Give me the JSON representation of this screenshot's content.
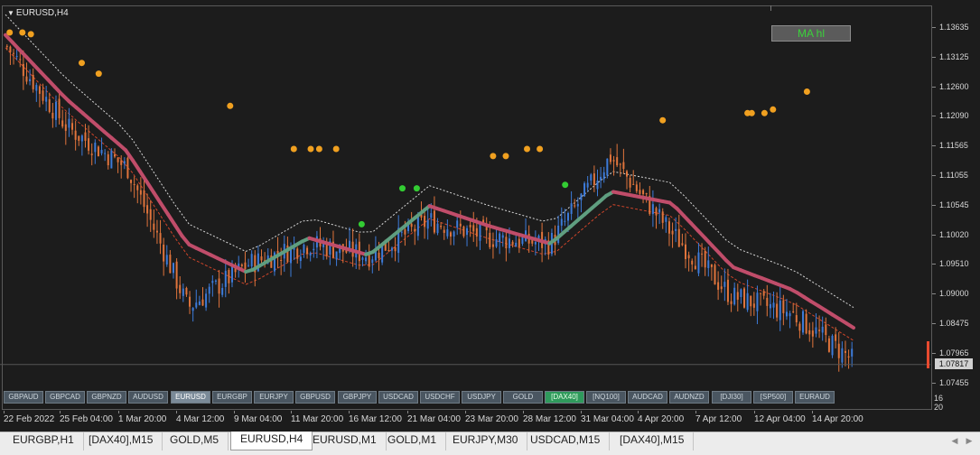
{
  "chart": {
    "symbol_label": "EURUSD,H4",
    "indicator_button": "MA hl",
    "current_price": "1.07817",
    "colors": {
      "background": "#1c1c1c",
      "bull_candle": "#3d7bd9",
      "bear_candle": "#e0743c",
      "ma_down": "#c04d6a",
      "ma_up": "#5f9e80",
      "dots_orange": "#f0a020",
      "dots_green": "#33cc33",
      "envelope_red": "#d0452a",
      "envelope_white": "#d8d8d8"
    },
    "price_axis_labels": [
      "1.13635",
      "1.13125",
      "1.12600",
      "1.12090",
      "1.11565",
      "1.11055",
      "1.10545",
      "1.10020",
      "1.09510",
      "1.09000",
      "1.08475",
      "1.07965",
      "1.07455"
    ],
    "time_axis_labels": [
      "22 Feb 2022",
      "25 Feb 04:00",
      "1 Mar 20:00",
      "4 Mar 12:00",
      "9 Mar 04:00",
      "11 Mar 20:00",
      "16 Mar 12:00",
      "21 Mar 04:00",
      "23 Mar 20:00",
      "28 Mar 12:00",
      "31 Mar 04:00",
      "4 Apr 20:00",
      "7 Apr 12:00",
      "12 Apr 04:00",
      "14 Apr 20:00"
    ],
    "bottom_right_labels": [
      "16",
      "20"
    ],
    "symbol_buttons": [
      {
        "label": "GBPAUD",
        "state": "normal"
      },
      {
        "label": "GBPCAD",
        "state": "normal"
      },
      {
        "label": "GBPNZD",
        "state": "normal"
      },
      {
        "label": "AUDUSD",
        "state": "normal"
      },
      {
        "label": "EURUSD",
        "state": "selected"
      },
      {
        "label": "EURGBP",
        "state": "normal"
      },
      {
        "label": "EURJPY",
        "state": "normal"
      },
      {
        "label": "GBPUSD",
        "state": "normal"
      },
      {
        "label": "GBPJPY",
        "state": "normal"
      },
      {
        "label": "USDCAD",
        "state": "normal"
      },
      {
        "label": "USDCHF",
        "state": "normal"
      },
      {
        "label": "USDJPY",
        "state": "normal"
      },
      {
        "label": "GOLD",
        "state": "normal"
      },
      {
        "label": "[DAX40]",
        "state": "highlight"
      },
      {
        "label": "[NQ100]",
        "state": "normal"
      },
      {
        "label": "AUDCAD",
        "state": "normal"
      },
      {
        "label": "AUDNZD",
        "state": "normal"
      },
      {
        "label": "[DJI30]",
        "state": "normal"
      },
      {
        "label": "[SP500]",
        "state": "normal"
      },
      {
        "label": "EURAUD",
        "state": "normal"
      }
    ]
  },
  "chart_data": {
    "type": "candlestick",
    "symbol": "EURUSD",
    "timeframe": "H4",
    "ylim": [
      1.07455,
      1.13635
    ],
    "x": [
      "22 Feb 2022",
      "25 Feb 04:00",
      "1 Mar 20:00",
      "4 Mar 12:00",
      "9 Mar 04:00",
      "11 Mar 20:00",
      "16 Mar 12:00",
      "21 Mar 04:00",
      "23 Mar 20:00",
      "28 Mar 12:00",
      "31 Mar 04:00",
      "4 Apr 20:00",
      "7 Apr 12:00",
      "12 Apr 04:00",
      "14 Apr 20:00"
    ],
    "close_approx": [
      1.133,
      1.119,
      1.112,
      1.088,
      1.0955,
      1.099,
      1.097,
      1.103,
      1.1,
      1.099,
      1.114,
      1.101,
      1.09,
      1.087,
      1.079
    ],
    "series": [
      {
        "name": "MA hl",
        "values": [
          1.135,
          1.124,
          1.115,
          1.099,
          1.094,
          1.1,
          1.097,
          1.1055,
          1.102,
          1.099,
          1.108,
          1.106,
          1.095,
          1.091,
          1.0845
        ]
      }
    ]
  },
  "tabs": [
    {
      "label": "EURGBP,H1",
      "active": false
    },
    {
      "label": "[DAX40],M15",
      "active": false
    },
    {
      "label": "GOLD,M5",
      "active": false
    },
    {
      "label": "EURUSD,H4",
      "active": true
    },
    {
      "label": "EURUSD,M1",
      "active": false
    },
    {
      "label": "GOLD,M1",
      "active": false
    },
    {
      "label": "EURJPY,M30",
      "active": false
    },
    {
      "label": "USDCAD,M15",
      "active": false
    },
    {
      "label": "[DAX40],M15",
      "active": false
    }
  ]
}
